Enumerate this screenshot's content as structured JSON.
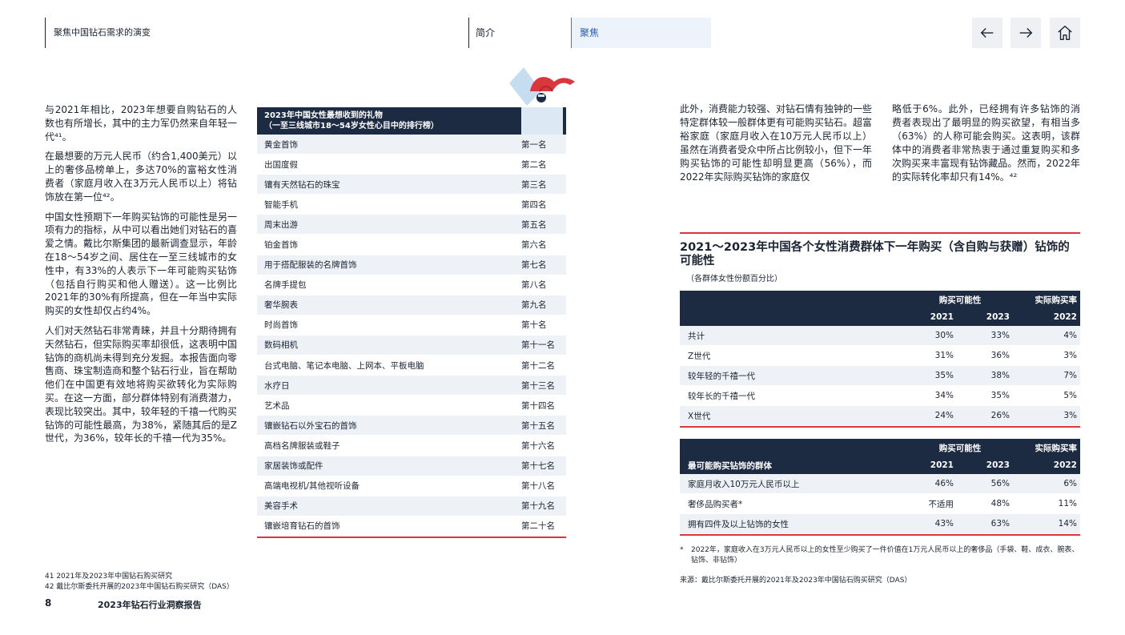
{
  "header": {
    "section_title": "聚焦中国钻石需求的演变",
    "tabs": [
      "简介",
      "聚焦"
    ]
  },
  "left_column": {
    "paragraphs": [
      "与2021年相比，2023年想要自购钻石的人数也有所增长，其中的主力军仍然来自年轻一代⁴¹。",
      "在最想要的万元人民币（约合1,400美元）以上的奢侈品榜单上，多达70%的富裕女性消费者（家庭月收入在3万元人民币以上）将钻饰放在第一位⁴²。",
      "中国女性预期下一年购买钻饰的可能性是另一项有力的指标，从中可以看出她们对钻石的喜爱之情。戴比尔斯集团的最新调查显示，年龄在18～54岁之间、居住在一至三线城市的女性中，有33%的人表示下一年可能购买钻饰（包括自行购买和他人赠送）。这一比例比2021年的30%有所提高，但在一年当中实际购买的女性却仅占约4%。",
      "人们对天然钻石非常青睐，并且十分期待拥有天然钻石，但实际购买率却很低，这表明中国钻饰的商机尚未得到充分发掘。本报告面向零售商、珠宝制造商和整个钻石行业，旨在帮助他们在中国更有效地将购买欲转化为实际购买。在这一方面，部分群体特别有消费潜力，表现比较突出。其中，较年轻的千禧一代购买钻饰的可能性最高，为38%，紧随其后的是Z世代，为36%，较年长的千禧一代为35%。"
    ],
    "footnotes": [
      "41 2021年及2023年中国钻石购买研究",
      "42 戴比尔斯委托开展的2023年中国钻石购买研究（DAS）"
    ]
  },
  "footer": {
    "page_number": "8",
    "report_title": "2023年钻石行业洞察报告"
  },
  "gift_table": {
    "title_line1": "2023年中国女性最想收到的礼物",
    "title_line2": "（一至三线城市18～54岁女性心目中的排行榜）",
    "rows": [
      {
        "item": "黄金首饰",
        "rank": "第一名"
      },
      {
        "item": "出国度假",
        "rank": "第二名"
      },
      {
        "item": "镶有天然钻石的珠宝",
        "rank": "第三名"
      },
      {
        "item": "智能手机",
        "rank": "第四名"
      },
      {
        "item": "周末出游",
        "rank": "第五名"
      },
      {
        "item": "铂金首饰",
        "rank": "第六名"
      },
      {
        "item": "用于搭配服装的名牌首饰",
        "rank": "第七名"
      },
      {
        "item": "名牌手提包",
        "rank": "第八名"
      },
      {
        "item": "奢华腕表",
        "rank": "第九名"
      },
      {
        "item": "时尚首饰",
        "rank": "第十名"
      },
      {
        "item": "数码相机",
        "rank": "第十一名"
      },
      {
        "item": "台式电脑、笔记本电脑、上网本、平板电脑",
        "rank": "第十二名"
      },
      {
        "item": "水疗日",
        "rank": "第十三名"
      },
      {
        "item": "艺术品",
        "rank": "第十四名"
      },
      {
        "item": "镶嵌钻石以外宝石的首饰",
        "rank": "第十五名"
      },
      {
        "item": "高档名牌服装或鞋子",
        "rank": "第十六名"
      },
      {
        "item": "家居装饰或配件",
        "rank": "第十七名"
      },
      {
        "item": "高端电视机/其他视听设备",
        "rank": "第十八名"
      },
      {
        "item": "美容手术",
        "rank": "第十九名"
      },
      {
        "item": "镶嵌培育钻石的首饰",
        "rank": "第二十名"
      }
    ]
  },
  "right_text": {
    "col1": "此外，消费能力较强、对钻石情有独钟的一些特定群体较一般群体更有可能购买钻石。超富裕家庭（家庭月收入在10万元人民币以上）虽然在消费者受众中所占比例较小，但下一年购买钻饰的可能性却明显更高（56%），而2022年实际购买钻饰的家庭仅",
    "col2": "略低于6%。此外，已经拥有许多钻饰的消费者表现出了最明显的购买欲望，有相当多（63%）的人称可能会购买。这表明，该群体中的消费者非常热衷于通过重复购买和多次购买来丰富现有钻饰藏品。然而，2022年的实际转化率却只有14%。⁴²"
  },
  "prob_section": {
    "title": "2021～2023年中国各个女性消费群体下一年购买（含自购与获赠）钻饰的可能性",
    "subtitle": "（各群体女性份额百分比）",
    "table1": {
      "group_header": "购买可能性",
      "actual_header": "实际购买率",
      "years": [
        "2021",
        "2023",
        "2022"
      ],
      "rows": [
        {
          "label": "共计",
          "v2021": "30%",
          "v2023": "33%",
          "actual": "4%"
        },
        {
          "label": "Z世代",
          "v2021": "31%",
          "v2023": "36%",
          "actual": "3%"
        },
        {
          "label": "较年轻的千禧一代",
          "v2021": "35%",
          "v2023": "38%",
          "actual": "7%"
        },
        {
          "label": "较年长的千禧一代",
          "v2021": "34%",
          "v2023": "35%",
          "actual": "5%"
        },
        {
          "label": "X世代",
          "v2021": "24%",
          "v2023": "26%",
          "actual": "3%"
        }
      ]
    },
    "table2": {
      "group_header": "购买可能性",
      "actual_header": "实际购买率",
      "row_header": "最可能购买钻饰的群体",
      "years": [
        "2021",
        "2023",
        "2022"
      ],
      "rows": [
        {
          "label": "家庭月收入10万元人民币以上",
          "v2021": "46%",
          "v2023": "56%",
          "actual": "6%"
        },
        {
          "label": "奢侈品购买者*",
          "v2021": "不适用",
          "v2023": "48%",
          "actual": "11%"
        },
        {
          "label": "拥有四件及以上钻饰的女性",
          "v2021": "43%",
          "v2023": "63%",
          "actual": "14%"
        }
      ]
    },
    "footnote_star": "*",
    "footnote": "2022年，家庭收入在3万元人民币以上的女性至少购买了一件价值在1万元人民币以上的奢侈品（手袋、鞋、成衣、腕表、钻饰、非钻饰）",
    "source": "来源：戴比尔斯委托开展的2021年及2023年中国钻石购买研究（DAS）"
  }
}
